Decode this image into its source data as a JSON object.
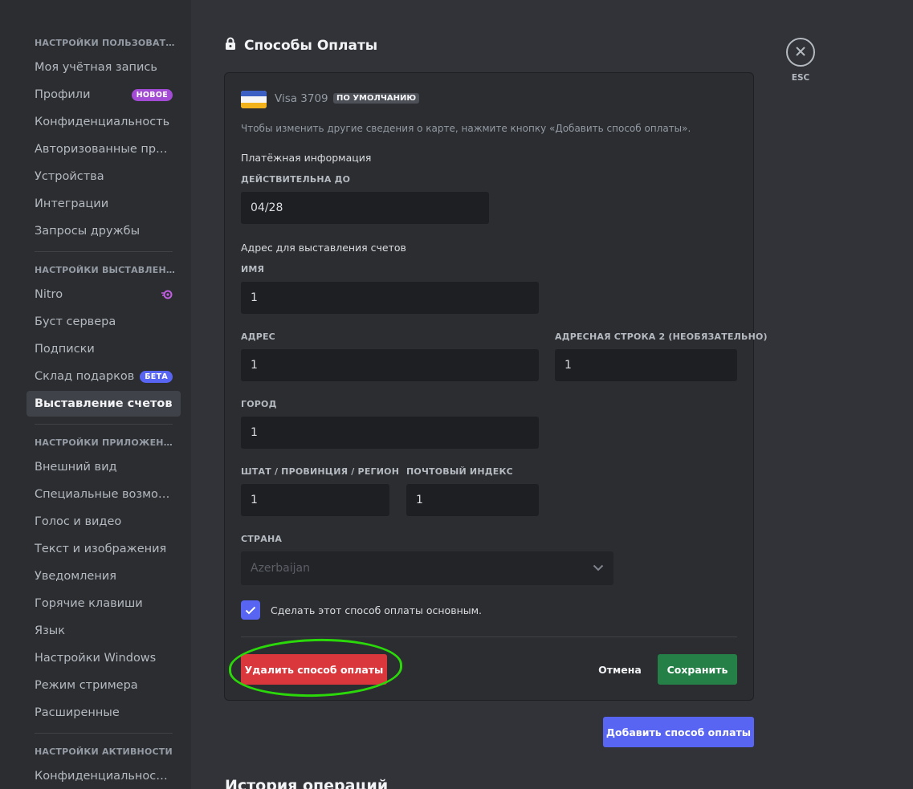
{
  "sidebar": {
    "sections": [
      {
        "header": "НАСТРОЙКИ ПОЛЬЗОВАТЕЛЯ",
        "items": [
          {
            "label": "Моя учётная запись"
          },
          {
            "label": "Профили",
            "badge": "НОВОЕ"
          },
          {
            "label": "Конфиденциальность"
          },
          {
            "label": "Авторизованные при..."
          },
          {
            "label": "Устройства"
          },
          {
            "label": "Интеграции"
          },
          {
            "label": "Запросы дружбы"
          }
        ]
      },
      {
        "header": "НАСТРОЙКИ ВЫСТАВЛЕНИЯ ...",
        "items": [
          {
            "label": "Nitro",
            "icon": "nitro-icon"
          },
          {
            "label": "Буст сервера"
          },
          {
            "label": "Подписки"
          },
          {
            "label": "Склад подарков",
            "badge": "БЕТА"
          },
          {
            "label": "Выставление счетов",
            "active": true
          }
        ]
      },
      {
        "header": "НАСТРОЙКИ ПРИЛОЖЕНИЯ",
        "items": [
          {
            "label": "Внешний вид"
          },
          {
            "label": "Специальные возмож..."
          },
          {
            "label": "Голос и видео"
          },
          {
            "label": "Текст и изображения"
          },
          {
            "label": "Уведомления"
          },
          {
            "label": "Горячие клавиши"
          },
          {
            "label": "Язык"
          },
          {
            "label": "Настройки Windows"
          },
          {
            "label": "Режим стримера"
          },
          {
            "label": "Расширенные"
          }
        ]
      },
      {
        "header": "НАСТРОЙКИ АКТИВНОСТИ",
        "items": [
          {
            "label": "Конфиденциальность..."
          }
        ]
      }
    ]
  },
  "main": {
    "title": "Способы Оплаты",
    "card": {
      "name": "Visa 3709",
      "default_tag": "ПО УМОЛЧАНИЮ",
      "hint": "Чтобы изменить другие сведения о карте, нажмите кнопку «Добавить способ оплаты».",
      "payment_info_heading": "Платёжная информация",
      "expiry_label": "ДЕЙСТВИТЕЛЬНА ДО",
      "expiry_value": "04/28",
      "billing_heading": "Адрес для выставления счетов",
      "name_label": "ИМЯ",
      "name_value": "1",
      "address_label": "АДРЕС",
      "address_value": "1",
      "address2_label": "АДРЕСНАЯ СТРОКА 2 (НЕОБЯЗАТЕЛЬНО)",
      "address2_value": "1",
      "city_label": "ГОРОД",
      "city_value": "1",
      "state_label": "ШТАТ / ПРОВИНЦИЯ / РЕГИОН",
      "state_value": "1",
      "zip_label": "ПОЧТОВЫЙ ИНДЕКС",
      "zip_value": "1",
      "country_label": "СТРАНА",
      "country_value": "Azerbaijan",
      "make_default_label": "Сделать этот способ оплаты основным.",
      "make_default_checked": true,
      "delete_button": "Удалить способ оплаты",
      "cancel_button": "Отмена",
      "save_button": "Сохранить"
    },
    "add_button": "Добавить способ оплаты",
    "history_title": "История операций"
  },
  "close": {
    "label": "ESC"
  },
  "colors": {
    "accent": "#5865f2",
    "danger": "#da373c",
    "success": "#248046",
    "annotation": "#2bd80a"
  }
}
